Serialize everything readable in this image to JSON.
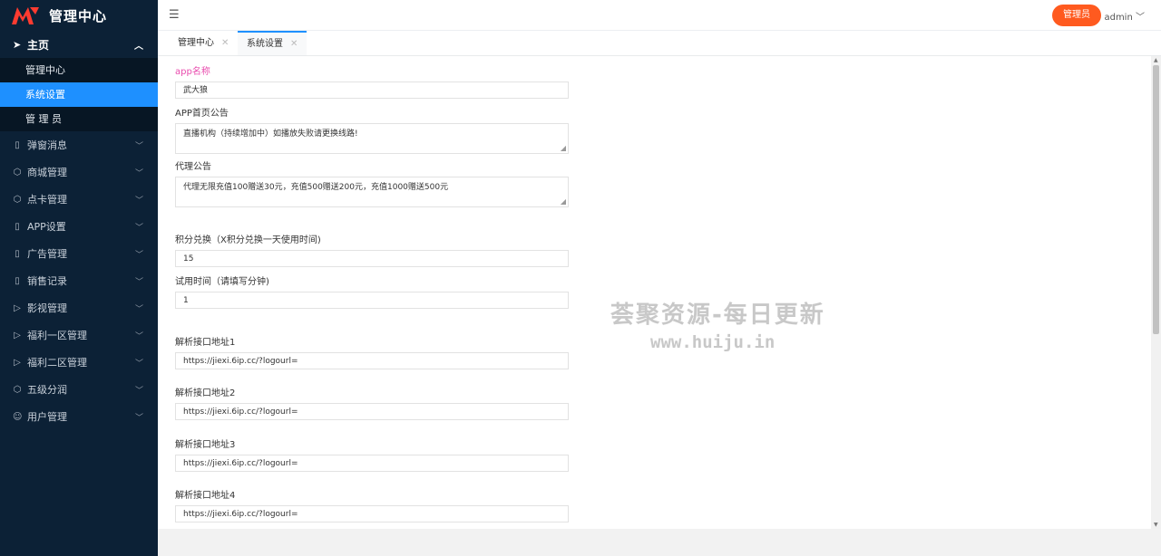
{
  "app": {
    "title": "管理中心"
  },
  "sidebar": {
    "home": {
      "label": "主页"
    },
    "home_sub": [
      {
        "label": "管理中心"
      },
      {
        "label": "系统设置"
      },
      {
        "label": "管 理 员"
      }
    ],
    "menu": [
      {
        "label": "弹窗消息",
        "icon": "mobile-icon"
      },
      {
        "label": "商城管理",
        "icon": "cube-icon"
      },
      {
        "label": "点卡管理",
        "icon": "cube-icon"
      },
      {
        "label": "APP设置",
        "icon": "mobile-icon"
      },
      {
        "label": "广告管理",
        "icon": "mobile-icon"
      },
      {
        "label": "销售记录",
        "icon": "mobile-icon"
      },
      {
        "label": "影视管理",
        "icon": "play-icon"
      },
      {
        "label": "福利一区管理",
        "icon": "play-icon"
      },
      {
        "label": "福利二区管理",
        "icon": "play-icon"
      },
      {
        "label": "五级分润",
        "icon": "cube-icon"
      },
      {
        "label": "用户管理",
        "icon": "user-icon"
      }
    ]
  },
  "header": {
    "role_button": "管理员",
    "user": "admin"
  },
  "tabs": [
    {
      "label": "管理中心"
    },
    {
      "label": "系统设置"
    }
  ],
  "form": {
    "app_name": {
      "label": "app名称",
      "value": "武大狼"
    },
    "home_notice": {
      "label": "APP首页公告",
      "value": "直播机构（持续增加中）如播放失败请更换线路!"
    },
    "agent_notice": {
      "label": "代理公告",
      "value": "代理无限充值100赠送30元，充值500赠送200元，充值1000赠送500元"
    },
    "points": {
      "label": "积分兑换（X积分兑换一天使用时间)",
      "value": "15"
    },
    "trial": {
      "label": "试用时间（请填写分钟)",
      "value": "1"
    },
    "api1": {
      "label": "解析接口地址1",
      "value": "https://jiexi.6ip.cc/?logourl="
    },
    "api2": {
      "label": "解析接口地址2",
      "value": "https://jiexi.6ip.cc/?logourl="
    },
    "api3": {
      "label": "解析接口地址3",
      "value": "https://jiexi.6ip.cc/?logourl="
    },
    "api4": {
      "label": "解析接口地址4",
      "value": "https://jiexi.6ip.cc/?logourl="
    }
  },
  "watermark": {
    "line1": "荟聚资源-每日更新",
    "line2": "www.huiju.in"
  },
  "colors": {
    "sidebar_bg": "#0c2136",
    "active": "#1e90ff",
    "accent": "#ff5a1f",
    "label_pink": "#e94cae"
  }
}
